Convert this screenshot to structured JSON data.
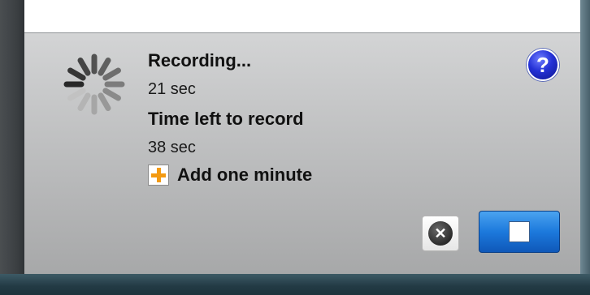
{
  "recording": {
    "status": "Recording...",
    "elapsed": "21 sec",
    "time_left_label": "Time left to record",
    "time_left_value": "38 sec"
  },
  "actions": {
    "add_minute_label": "Add one minute",
    "help_glyph": "?",
    "cancel_glyph": "✕"
  },
  "icons": {
    "spinner": "loading-spinner-icon",
    "add": "plus-icon",
    "help": "question-mark-icon",
    "cancel": "close-circle-icon",
    "stop": "stop-square-icon"
  },
  "colors": {
    "stop_button": "#1c79dc",
    "help_button": "#2431d6",
    "add_icon": "#f39a12"
  }
}
